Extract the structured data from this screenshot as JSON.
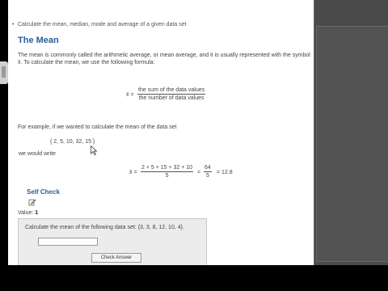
{
  "intro_bullet": "Calculate the mean, median, mode and average of a given data set",
  "section_title": "The Mean",
  "paragraph": {
    "line1": "The mean is commonly called the arithmetic average, or mean average, and it is usually represented with the symbol",
    "line2": "x̄.  To calculate the mean, we use the following formula:"
  },
  "formula_general": {
    "lhs": "x̄ =",
    "numerator": "the sum of the data values",
    "denominator": "the number of data values"
  },
  "example_intro": "For example, if we wanted to calculate the mean of the data set",
  "example_set": "{ 2, 5, 10, 32, 15 }",
  "we_would_write": "we would write",
  "formula_example": {
    "lhs": "x̄ =",
    "numerator": "2 + 5 + 15 + 32 + 10",
    "denominator": "5",
    "eq": "=",
    "result_num": "64",
    "result_den": "5",
    "final": "= 12.8"
  },
  "self_check": {
    "title": "Self Check",
    "icon": "pencil-edit-icon",
    "value_label": "Value:",
    "value": "1",
    "question": "Calculate the mean of the following data set: {3, 3, 8, 12, 10, 4}.",
    "answer_value": "",
    "check_button_label": "Check Answer"
  },
  "colors": {
    "heading": "#2a5d9b",
    "panel_bg": "#4a4a4a",
    "question_box_bg": "#ececec"
  }
}
